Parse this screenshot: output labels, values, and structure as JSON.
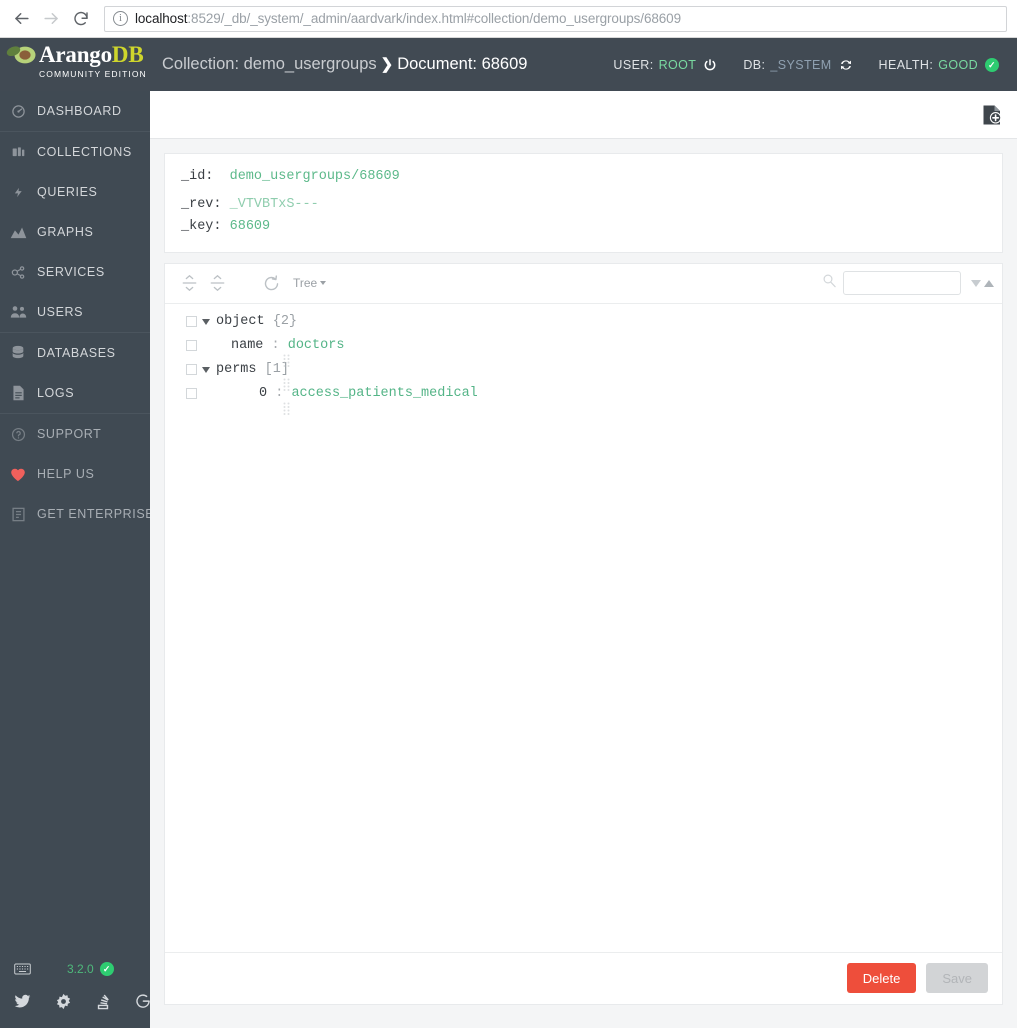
{
  "browser": {
    "back_label": "back",
    "forward_label": "forward",
    "reload_label": "reload",
    "url_host": "localhost",
    "url_rest": ":8529/_db/_system/_admin/aardvark/index.html#collection/demo_usergroups/68609"
  },
  "navbar": {
    "logo_primary": "Arango",
    "logo_accent": "DB",
    "logo_subtitle": "COMMUNITY EDITION",
    "breadcrumb": {
      "collection": "Collection: demo_usergroups",
      "separator": "❯",
      "document": "Document: 68609"
    },
    "status": [
      {
        "label": "USER:",
        "value": "ROOT",
        "icon": "power-icon"
      },
      {
        "label": "DB:",
        "value": "_SYSTEM",
        "icon": "refresh-icon"
      },
      {
        "label": "HEALTH:",
        "value": "GOOD",
        "icon": "check-circle-icon"
      }
    ]
  },
  "sidebar": {
    "items": [
      {
        "label": "DASHBOARD",
        "icon": "dashboard-icon"
      },
      {
        "label": "COLLECTIONS",
        "icon": "collections-icon"
      },
      {
        "label": "QUERIES",
        "icon": "queries-icon"
      },
      {
        "label": "GRAPHS",
        "icon": "graphs-icon"
      },
      {
        "label": "SERVICES",
        "icon": "services-icon"
      },
      {
        "label": "USERS",
        "icon": "users-icon"
      },
      {
        "label": "DATABASES",
        "icon": "databases-icon"
      },
      {
        "label": "LOGS",
        "icon": "logs-icon"
      },
      {
        "label": "SUPPORT",
        "icon": "support-icon"
      },
      {
        "label": "HELP US",
        "icon": "heart-icon"
      },
      {
        "label": "GET ENTERPRISE",
        "icon": "enterprise-icon"
      }
    ],
    "footer": {
      "version": "3.2.0",
      "version_status": "ok",
      "keyboard_icon": "keyboard-icon",
      "social": [
        {
          "name": "twitter-icon"
        },
        {
          "name": "puzzle-icon"
        },
        {
          "name": "stackoverflow-icon"
        },
        {
          "name": "google-icon"
        }
      ]
    }
  },
  "content": {
    "header": {
      "add_document_icon": "new-document-icon"
    },
    "document_meta": [
      {
        "key": "_id:",
        "value": "demo_usergroups/68609"
      },
      {
        "key": "_rev:",
        "value": "_VTVBTxS---"
      },
      {
        "key": "_key:",
        "value": "68609"
      }
    ],
    "editor": {
      "toolbar": {
        "expand_all_label": "expand-all",
        "collapse_all_label": "collapse-all",
        "undo_label": "undo",
        "mode_label": "Tree",
        "search_icon": "search-icon",
        "search_value": "",
        "search_placeholder": "",
        "next_label": "next-match",
        "prev_label": "previous-match"
      },
      "tree": [
        {
          "indent": 0,
          "twisty": true,
          "key": "object",
          "sep": "",
          "value": "",
          "meta": "{2}",
          "drag": false
        },
        {
          "indent": 1,
          "twisty": false,
          "key": "name",
          "sep": ":",
          "value": "doctors",
          "meta": "",
          "drag": true
        },
        {
          "indent": 1,
          "twisty": true,
          "key": "perms",
          "sep": "",
          "value": "",
          "meta": "[1]",
          "drag": true
        },
        {
          "indent": 2,
          "twisty": false,
          "key": "0",
          "sep": ":",
          "value": "access_patients_medical",
          "meta": "",
          "drag": true
        }
      ]
    },
    "footer": {
      "delete_label": "Delete",
      "save_label": "Save"
    }
  },
  "colors": {
    "navbar": "#414a53",
    "sidebar": "#404a53",
    "accent_green": "#5cb98a",
    "logo_accent": "#cfd62c",
    "delete_red": "#ee4e3b",
    "save_disabled": "#d2d4d6",
    "health_green": "#2ecc71"
  }
}
